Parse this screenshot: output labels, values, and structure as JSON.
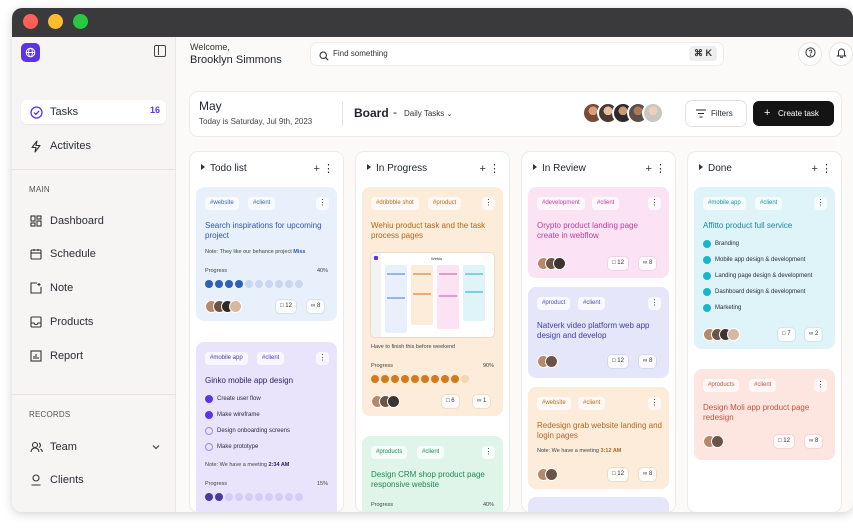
{
  "window": {
    "colors": {
      "close": "#fe5f57",
      "minimize": "#febc2e",
      "zoom": "#28c840"
    }
  },
  "sidebar": {
    "primary": [
      {
        "label": "Tasks",
        "count": "16",
        "icon": "circle-check-icon",
        "active": true
      },
      {
        "label": "Activites",
        "icon": "lightning-icon"
      }
    ],
    "main_heading": "MAIN",
    "main_items": [
      {
        "label": "Dashboard",
        "icon": "dashboard-icon"
      },
      {
        "label": "Schedule",
        "icon": "calendar-icon"
      },
      {
        "label": "Note",
        "icon": "note-icon"
      },
      {
        "label": "Products",
        "icon": "inbox-icon"
      },
      {
        "label": "Report",
        "icon": "report-icon"
      }
    ],
    "records_heading": "RECORDS",
    "records_items": [
      {
        "label": "Team",
        "icon": "users-icon"
      },
      {
        "label": "Clients",
        "icon": "user-icon"
      }
    ]
  },
  "topbar": {
    "welcome": "Welcome,",
    "user_name": "Brooklyn Simmons",
    "search_placeholder": "Find something",
    "shortcut": "⌘ K"
  },
  "header": {
    "month": "May",
    "today": "Today is Saturday, Jul 9th, 2023",
    "board": "Board",
    "dash": "-",
    "view": "Daily Tasks",
    "filters": "Filters",
    "create": "Create task"
  },
  "accent": "#5b34e6",
  "columns": [
    {
      "title": "Todo list",
      "cards": [
        {
          "tags": [
            "#website",
            "#client"
          ],
          "title": "Search inspirations for upcoming project",
          "note": "Note: They like our behance project ",
          "note_strong": "Miss",
          "progress_label": "Progress",
          "progress": "40%",
          "progress_fraction": 0.4,
          "comments": "12",
          "attachments": "8"
        },
        {
          "tags": [
            "#mobile app",
            "#client"
          ],
          "title": "Ginko mobile app design",
          "checklist": [
            {
              "label": "Create user flow",
              "done": true
            },
            {
              "label": "Make wireframe",
              "done": true
            },
            {
              "label": "Design onboarding screens",
              "done": false
            },
            {
              "label": "Make prototype",
              "done": false
            }
          ],
          "note": "Note: We have a meeting ",
          "note_strong": "2:34 AM",
          "progress_label": "Progress",
          "progress": "15%",
          "progress_fraction": 0.15
        }
      ]
    },
    {
      "title": "In Progress",
      "cards": [
        {
          "tags": [
            "#dribbble shot",
            "#product"
          ],
          "title": "Wehiu product task and the task process pages",
          "note": "Have to finish this before weekend",
          "progress_label": "Progress",
          "progress": "90%",
          "progress_fraction": 0.9,
          "comments": "6",
          "attachments": "1"
        },
        {
          "tags": [
            "#products",
            "#client"
          ],
          "title": "Design CRM shop product page responsive website",
          "progress_label": "Progress",
          "progress": "40%"
        }
      ]
    },
    {
      "title": "In Review",
      "cards": [
        {
          "tags": [
            "#development",
            "#client"
          ],
          "title": "Orypto product landing page create in webflow",
          "comments": "12",
          "attachments": "8"
        },
        {
          "tags": [
            "#product",
            "#client"
          ],
          "title": "Natverk video platform web app design and develop",
          "comments": "12",
          "attachments": "8"
        },
        {
          "tags": [
            "#website",
            "#client"
          ],
          "title": "Redesign grab website landing and login pages",
          "note": "Note: We have a meeting ",
          "note_strong": "3:12 AM",
          "comments": "12",
          "attachments": "8"
        }
      ]
    },
    {
      "title": "Done",
      "cards": [
        {
          "tags": [
            "#mobile app",
            "#client"
          ],
          "title": "Affitto product full service",
          "checklist": [
            {
              "label": "Branding",
              "done": true
            },
            {
              "label": "Mobile app design & development",
              "done": true
            },
            {
              "label": "Landing page design & development",
              "done": true
            },
            {
              "label": "Dashboard design & development",
              "done": true
            },
            {
              "label": "Marketing",
              "done": true
            }
          ],
          "comments": "7",
          "attachments": "2"
        },
        {
          "tags": [
            "#products",
            "#client"
          ],
          "title": "Design Moli app product page redesign",
          "comments": "12",
          "attachments": "8"
        }
      ]
    }
  ],
  "shot": {
    "brand": "Wehiu"
  }
}
